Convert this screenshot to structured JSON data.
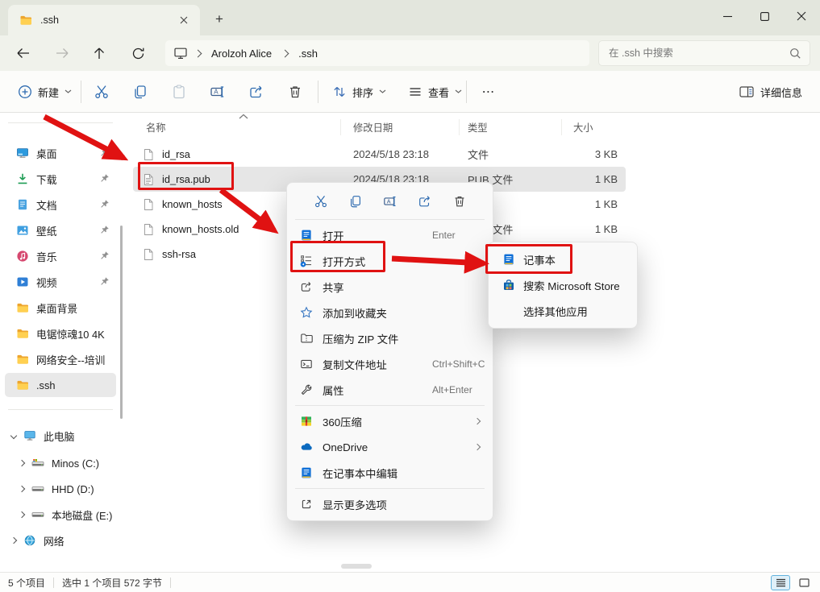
{
  "colors": {
    "annotation_red": "#e01212",
    "accent_blue": "#2e6bb0",
    "selection_gray": "#e6e6e6"
  },
  "window": {
    "tab_title": ".ssh",
    "new_tab_label": "+"
  },
  "navbar": {
    "breadcrumb": {
      "root_icon": "monitor-icon",
      "items": [
        "Arolzoh Alice",
        ".ssh"
      ]
    },
    "search": {
      "placeholder": "在 .ssh 中搜索",
      "icon": "search-icon"
    }
  },
  "toolbar": {
    "new_label": "新建",
    "sort_label": "排序",
    "view_label": "查看",
    "more_label": "⋯",
    "details_label": "详细信息",
    "icons": [
      "new-icon",
      "cut-icon",
      "copy-icon",
      "paste-icon",
      "rename-icon",
      "share-icon",
      "delete-icon",
      "sort-icon",
      "view-icon",
      "more-icon",
      "details-pane-icon"
    ]
  },
  "sidebar": {
    "quick": [
      {
        "label": "桌面",
        "icon": "desktop-icon",
        "pinned": true
      },
      {
        "label": "下载",
        "icon": "downloads-icon",
        "pinned": true
      },
      {
        "label": "文档",
        "icon": "documents-icon",
        "pinned": true
      },
      {
        "label": "壁纸",
        "icon": "pictures-icon",
        "pinned": true
      },
      {
        "label": "音乐",
        "icon": "music-icon",
        "pinned": true
      },
      {
        "label": "视频",
        "icon": "videos-icon",
        "pinned": true
      }
    ],
    "folders": [
      {
        "label": "桌面背景",
        "icon": "folder-icon"
      },
      {
        "label": "电锯惊魂10 4K",
        "icon": "folder-icon"
      },
      {
        "label": "网络安全--培训",
        "icon": "folder-icon"
      },
      {
        "label": ".ssh",
        "icon": "folder-icon",
        "selected": true
      }
    ],
    "tree": {
      "this_pc": "此电脑",
      "drives": [
        "Minos (C:)",
        "HHD (D:)",
        "本地磁盘 (E:)"
      ],
      "network": "网络"
    }
  },
  "filelist": {
    "columns": [
      "名称",
      "修改日期",
      "类型",
      "大小"
    ],
    "sort": {
      "column": "名称",
      "direction": "asc"
    },
    "rows": [
      {
        "name": "id_rsa",
        "date": "2024/5/18 23:18",
        "type": "文件",
        "size": "3 KB",
        "icon": "file-blank-icon"
      },
      {
        "name": "id_rsa.pub",
        "date": "2024/5/18 23:18",
        "type": "PUB 文件",
        "size": "1 KB",
        "icon": "file-text-icon",
        "selected": true
      },
      {
        "name": "known_hosts",
        "date": "",
        "type": "",
        "size": "1 KB",
        "icon": "file-blank-icon"
      },
      {
        "name": "known_hosts.old",
        "date": "",
        "type": "OLD 文件",
        "size": "1 KB",
        "icon": "file-blank-icon"
      },
      {
        "name": "ssh-rsa",
        "date": "",
        "type": "",
        "size": "",
        "icon": "file-blank-icon"
      }
    ]
  },
  "context_menu": {
    "quick_icons": [
      "cut-icon",
      "copy-icon",
      "rename-icon",
      "share-icon",
      "delete-icon"
    ],
    "items": [
      {
        "label": "打开",
        "shortcut": "Enter",
        "icon": "notepad-icon"
      },
      {
        "label": "打开方式",
        "icon": "open-with-icon",
        "has_submenu": true
      },
      {
        "label": "共享",
        "icon": "share-icon"
      },
      {
        "label": "添加到收藏夹",
        "icon": "star-icon"
      },
      {
        "label": "压缩为 ZIP 文件",
        "icon": "zip-folder-icon"
      },
      {
        "label": "复制文件地址",
        "shortcut": "Ctrl+Shift+C",
        "icon": "copy-path-icon"
      },
      {
        "label": "属性",
        "shortcut": "Alt+Enter",
        "icon": "wrench-icon"
      },
      {
        "label": "360压缩",
        "icon": "archive-360-icon",
        "has_submenu": true
      },
      {
        "label": "OneDrive",
        "icon": "onedrive-icon",
        "has_submenu": true
      },
      {
        "label": "在记事本中编辑",
        "icon": "notepad-icon"
      },
      {
        "label": "显示更多选项",
        "icon": "show-more-icon"
      }
    ]
  },
  "submenu": {
    "items": [
      {
        "label": "记事本",
        "icon": "notepad-icon"
      },
      {
        "label": "搜索 Microsoft Store",
        "icon": "ms-store-icon"
      },
      {
        "label": "选择其他应用",
        "icon": ""
      }
    ]
  },
  "statusbar": {
    "count": "5 个项目",
    "selection": "选中 1 个项目  572 字节"
  }
}
